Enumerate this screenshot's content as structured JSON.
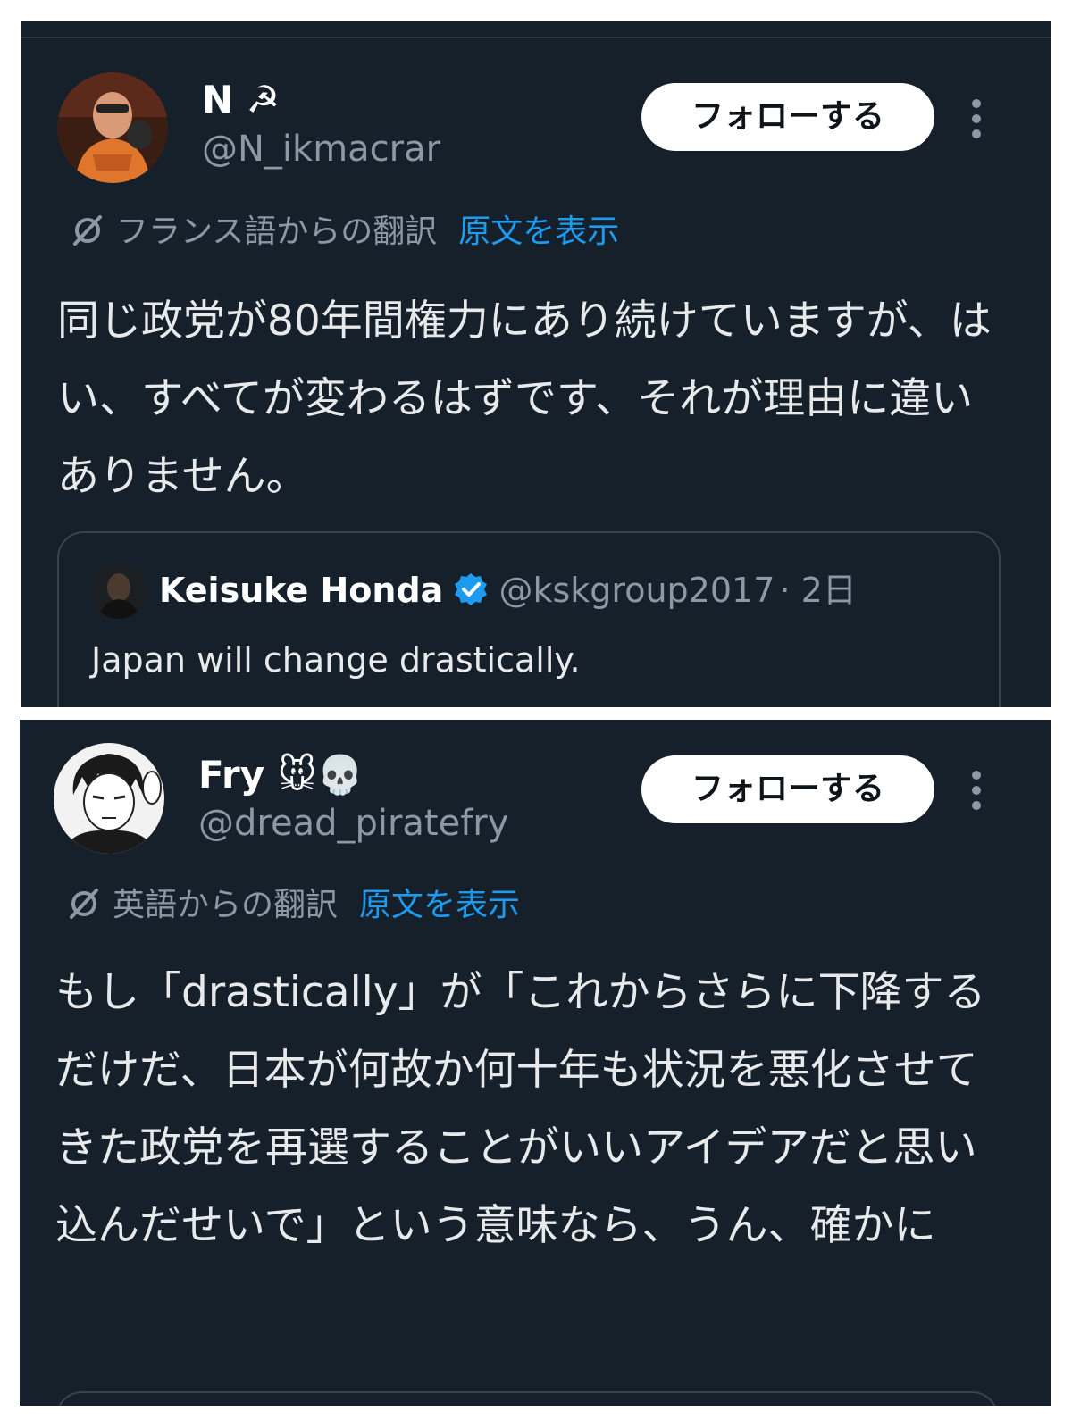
{
  "tweets": [
    {
      "display_name": "N ☭",
      "handle": "@N_ikmacrar",
      "follow_label": "フォローする",
      "translation_label": "フランス語からの翻訳",
      "show_original_label": "原文を表示",
      "text": "同じ政党が80年間権力にあり続けていますが、はい、すべてが変わるはずです、それが理由に違いありません。",
      "quote": {
        "name": "Keisuke Honda",
        "handle": "@kskgroup2017",
        "time": "· 2日",
        "text": "Japan will change drastically."
      }
    },
    {
      "display_name": "Fry 🐭💀",
      "handle": "@dread_piratefry",
      "follow_label": "フォローする",
      "translation_label": "英語からの翻訳",
      "show_original_label": "原文を表示",
      "text": "もし「drastically」が「これからさらに下降するだけだ、日本が何故か何十年も状況を悪化させてきた政党を再選することがいいアイデアだと思い込んだせいで」という意味なら、うん、確かに"
    }
  ],
  "colors": {
    "background": "#15202b",
    "text": "#e7e9ea",
    "secondary_text": "#8b98a5",
    "link": "#1d9bf0",
    "follow_button_bg": "#ffffff",
    "verified_badge": "#1d9bf0"
  }
}
